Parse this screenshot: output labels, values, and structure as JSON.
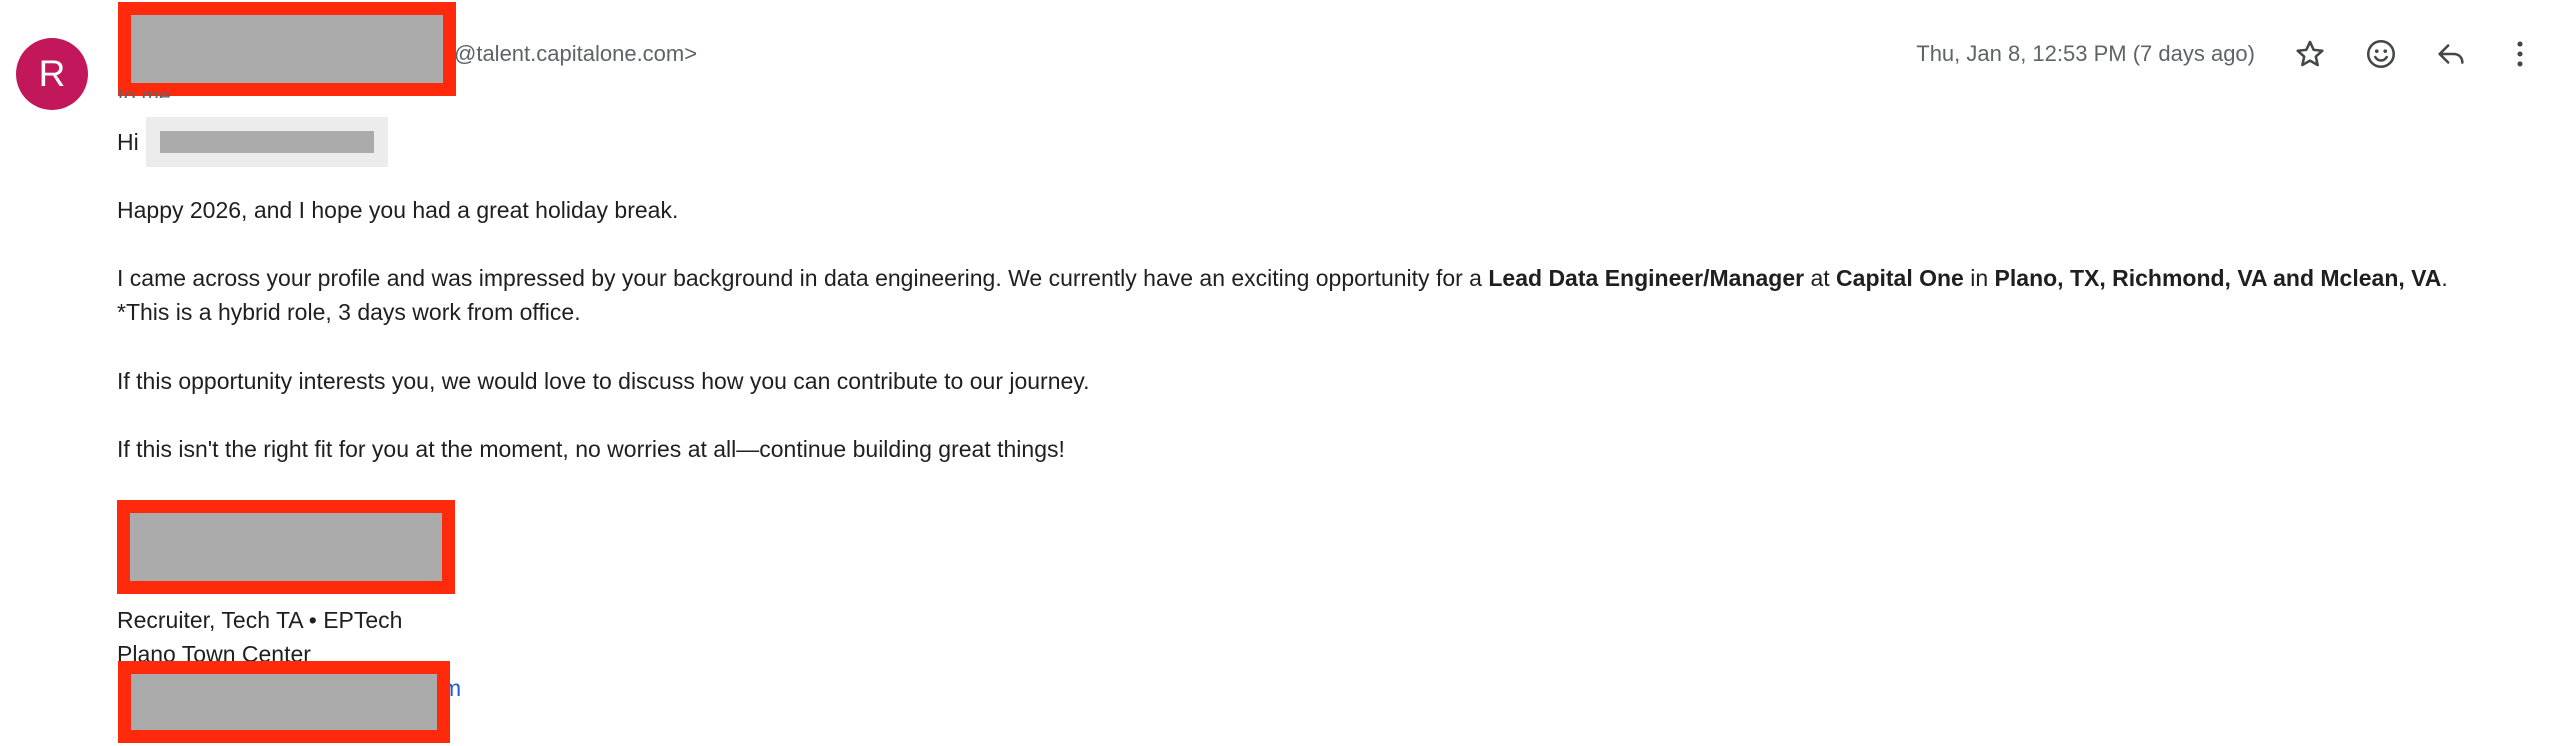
{
  "sender": {
    "avatar_initial": "R",
    "avatar_color": "#c2185b",
    "domain_text": "@talent.capitalone.com>",
    "recipient_text": "to me"
  },
  "meta": {
    "date_text": "Thu, Jan 8, 12:53 PM (7 days ago)"
  },
  "actions": {
    "star": "star-icon",
    "emoji": "emoji-icon",
    "reply": "reply-icon",
    "more": "more-vert-icon"
  },
  "body": {
    "greeting_prefix": "Hi",
    "para1": "Happy 2026, and I hope you had a great holiday break.",
    "para2_a": "I came across your profile and was impressed by your background in data engineering. We currently have an exciting opportunity for a ",
    "para2_role": "Lead Data Engineer/Manager",
    "para2_at": " at ",
    "para2_company": "Capital One",
    "para2_in": " in ",
    "para2_locations": "Plano, TX, Richmond, VA and Mclean, VA",
    "para2_end": ".",
    "para2_line2": "*This is a hybrid role, 3 days work from office.",
    "para3": "If this opportunity interests you, we would love to discuss how you can contribute to our journey.",
    "para4": "If this isn't the right fit for you at the moment, no worries at all—continue building great things!"
  },
  "signature": {
    "title": "Recruiter, Tech TA • EPTech",
    "location": "Plano Town Center",
    "link_tail": "m"
  },
  "colors": {
    "redaction_border": "#ff2a0c",
    "redaction_fill": "#ababab",
    "link": "#1a5bd6"
  }
}
